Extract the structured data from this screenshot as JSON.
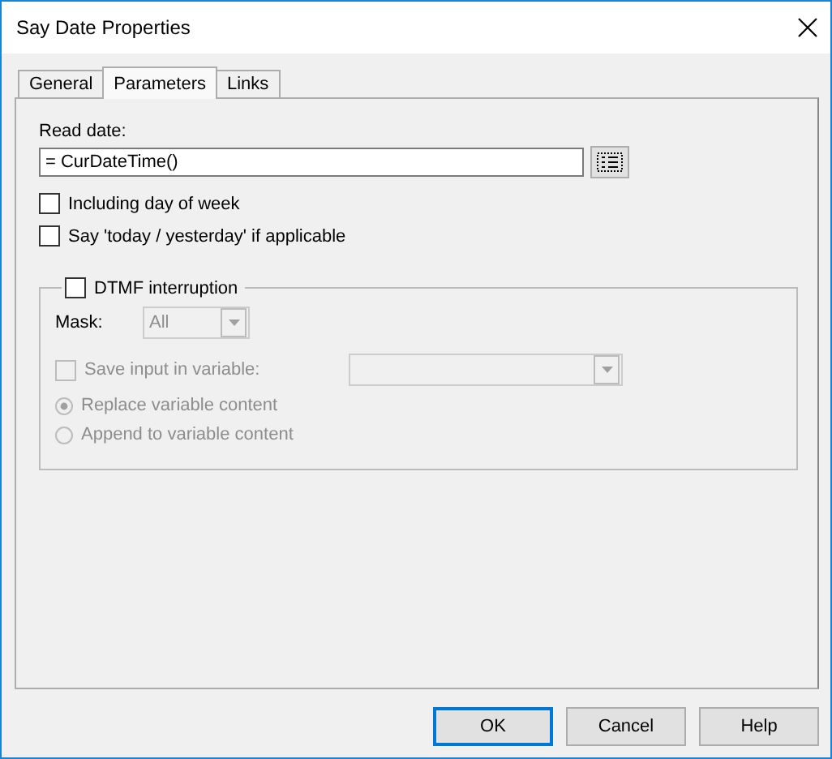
{
  "window": {
    "title": "Say Date Properties"
  },
  "tabs": [
    {
      "label": "General",
      "selected": false
    },
    {
      "label": "Parameters",
      "selected": true
    },
    {
      "label": "Links",
      "selected": false
    }
  ],
  "read_date": {
    "label": "Read date:",
    "value": "= CurDateTime()"
  },
  "options": [
    {
      "label": "Including day of week",
      "checked": false
    },
    {
      "label": "Say 'today / yesterday' if applicable",
      "checked": false
    }
  ],
  "dtmf": {
    "label": "DTMF interruption",
    "checked": false,
    "mask": {
      "label": "Mask:",
      "value": "All",
      "disabled": true
    },
    "save_input": {
      "label": "Save input in variable:",
      "checked": false,
      "disabled": true
    },
    "variable_field": {
      "disabled": true
    },
    "radios": [
      {
        "label": "Replace variable content",
        "selected": true,
        "disabled": true
      },
      {
        "label": "Append to variable content",
        "selected": false,
        "disabled": true
      }
    ]
  },
  "buttons": [
    "OK",
    "Cancel",
    "Help"
  ]
}
